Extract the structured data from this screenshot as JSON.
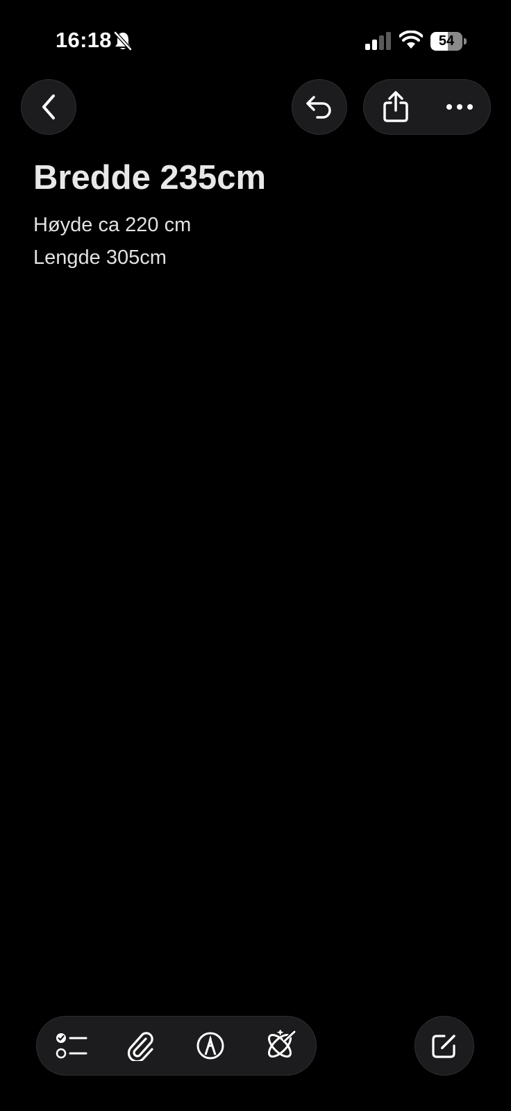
{
  "status_bar": {
    "time": "16:18",
    "battery_level": "54",
    "battery_fraction": 0.54,
    "icons": [
      "bell-slash-icon",
      "signal-icon",
      "wifi-icon",
      "battery-icon"
    ]
  },
  "toolbar": {
    "icons": [
      "back-chevron-icon",
      "undo-icon",
      "share-icon",
      "more-icon"
    ]
  },
  "note": {
    "title": "Bredde 235cm",
    "lines": [
      "Høyde ca 220 cm",
      "Lengde 305cm"
    ]
  },
  "bottom_bar": {
    "icons": [
      "checklist-icon",
      "paperclip-icon",
      "markup-pen-icon",
      "apple-intelligence-icon",
      "compose-icon"
    ]
  },
  "colors": {
    "background": "#000000",
    "button_fill": "#1c1c1e",
    "text": "#e8e8e8"
  }
}
